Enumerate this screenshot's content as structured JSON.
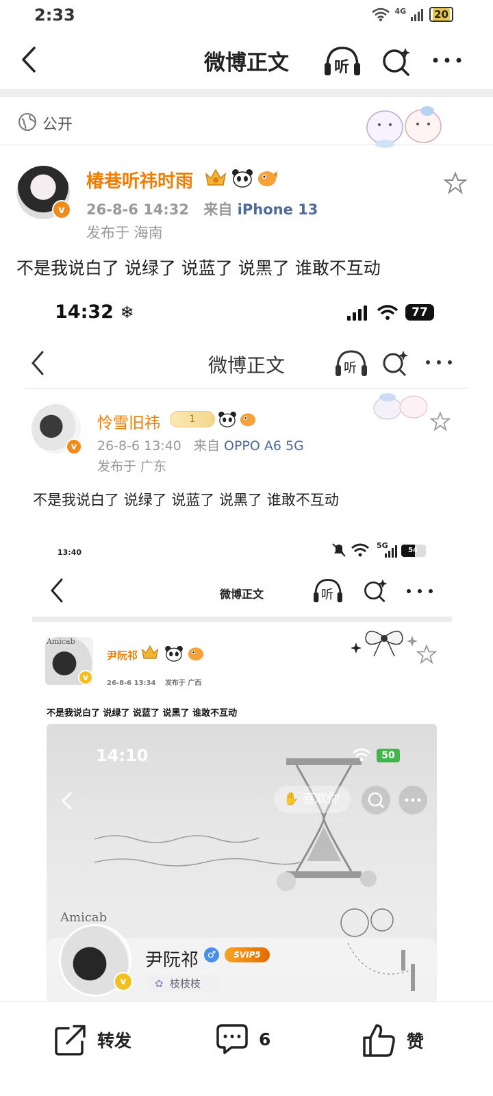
{
  "status_bar": {
    "time": "2:33",
    "network": "4G",
    "battery": "20"
  },
  "nav": {
    "title": "微博正文",
    "listen_label": "听"
  },
  "visibility": {
    "label": "公开"
  },
  "post": {
    "username": "椿巷听祎时雨",
    "timestamp": "26-8-6 14:32",
    "source_prefix": "来自",
    "source": "iPhone 13",
    "location": "发布于 海南",
    "text": "不是我说白了 说绿了 说蓝了 说黑了 谁敢不互动"
  },
  "embedded_1": {
    "status_time": "14:32",
    "battery": "77",
    "nav_title": "微博正文",
    "listen_label": "听",
    "username": "怜雪旧祎",
    "badge_level": "1",
    "timestamp": "26-8-6 13:40",
    "source_prefix": "来自",
    "source": "OPPO A6 5G",
    "location": "发布于 广东",
    "text": "不是我说白了 说绿了 说蓝了 说黑了 谁敢不互动"
  },
  "embedded_2": {
    "status_time": "13:40",
    "network": "5G",
    "battery": "54",
    "nav_title": "微博正文",
    "listen_label": "听",
    "username": "尹阮祁",
    "avatar_text": "Amicab",
    "timestamp": "26-8-6 13:34",
    "location": "发布于 广西",
    "text": "不是我说白了 说绿了 说蓝了 说黑了 谁敢不互动"
  },
  "embedded_3": {
    "status_time": "14:10",
    "battery": "50",
    "like_label": "喜欢你",
    "profile_name": "尹阮祁",
    "vip": "SVIP5",
    "avatar_text": "Amicab",
    "chip": "枝枝枝"
  },
  "toolbar": {
    "repost_label": "转发",
    "comment_count": "6",
    "like_label": "赞"
  },
  "colors": {
    "accent": "#f07d00",
    "source_link": "#4d6a9a",
    "vip_orange": "#f08a1b"
  }
}
